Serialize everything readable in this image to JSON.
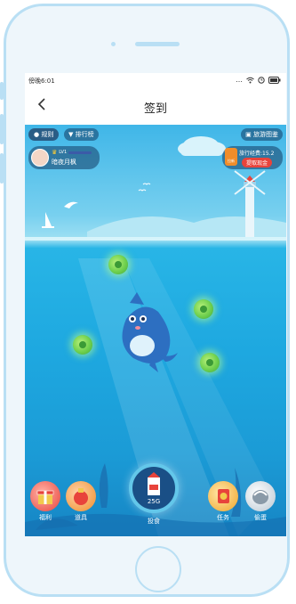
{
  "status_bar": {
    "time": "傍晚6:01",
    "icons": [
      "dots-icon",
      "wifi-icon",
      "alarm-icon",
      "battery-icon"
    ]
  },
  "navbar": {
    "back_icon": "chevron-left-icon",
    "title": "签到"
  },
  "top_left": {
    "rules_label": "规则",
    "ranking_label": "排行榜"
  },
  "top_right": {
    "guide_label": "旅游图鉴"
  },
  "profile": {
    "level": "LV1",
    "name": "暗夜月枫"
  },
  "travel": {
    "badge": "拉新",
    "text": "旅行经费:15.2",
    "action": "提取现金"
  },
  "feed": {
    "label": "投食",
    "amount": "25G"
  },
  "bottom_nav": [
    {
      "label": "福利",
      "icon": "gift-icon"
    },
    {
      "label": "道具",
      "icon": "potion-icon"
    },
    {
      "label": "任务",
      "icon": "task-icon"
    },
    {
      "label": "偷蛋",
      "icon": "egg-icon"
    }
  ],
  "colors": {
    "sky": "#3fb6e8",
    "ocean": "#1b9bd6",
    "accent_red": "#e8433b",
    "coin_green": "#6fd04e"
  }
}
